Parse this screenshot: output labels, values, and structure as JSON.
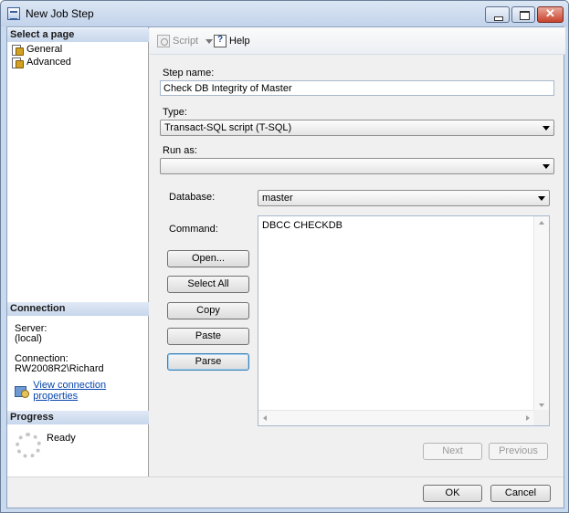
{
  "window": {
    "title": "New Job Step"
  },
  "left_pane": {
    "select_page_header": "Select a page",
    "pages": [
      {
        "label": "General"
      },
      {
        "label": "Advanced"
      }
    ],
    "connection_header": "Connection",
    "server_label": "Server:",
    "server_value": "(local)",
    "connection_label": "Connection:",
    "connection_value": "RW2008R2\\Richard",
    "view_properties_link": "View connection properties",
    "progress_header": "Progress",
    "progress_status": "Ready"
  },
  "toolbar": {
    "script_label": "Script",
    "help_label": "Help"
  },
  "form": {
    "step_name_label": "Step name:",
    "step_name_value": "Check DB Integrity of Master",
    "type_label": "Type:",
    "type_value": "Transact-SQL script (T-SQL)",
    "run_as_label": "Run as:",
    "run_as_value": "",
    "database_label": "Database:",
    "database_value": "master",
    "command_label": "Command:",
    "command_value": "DBCC CHECKDB",
    "buttons": {
      "open": "Open...",
      "select_all": "Select All",
      "copy": "Copy",
      "paste": "Paste",
      "parse": "Parse"
    },
    "next_label": "Next",
    "previous_label": "Previous"
  },
  "dialog_buttons": {
    "ok": "OK",
    "cancel": "Cancel"
  }
}
